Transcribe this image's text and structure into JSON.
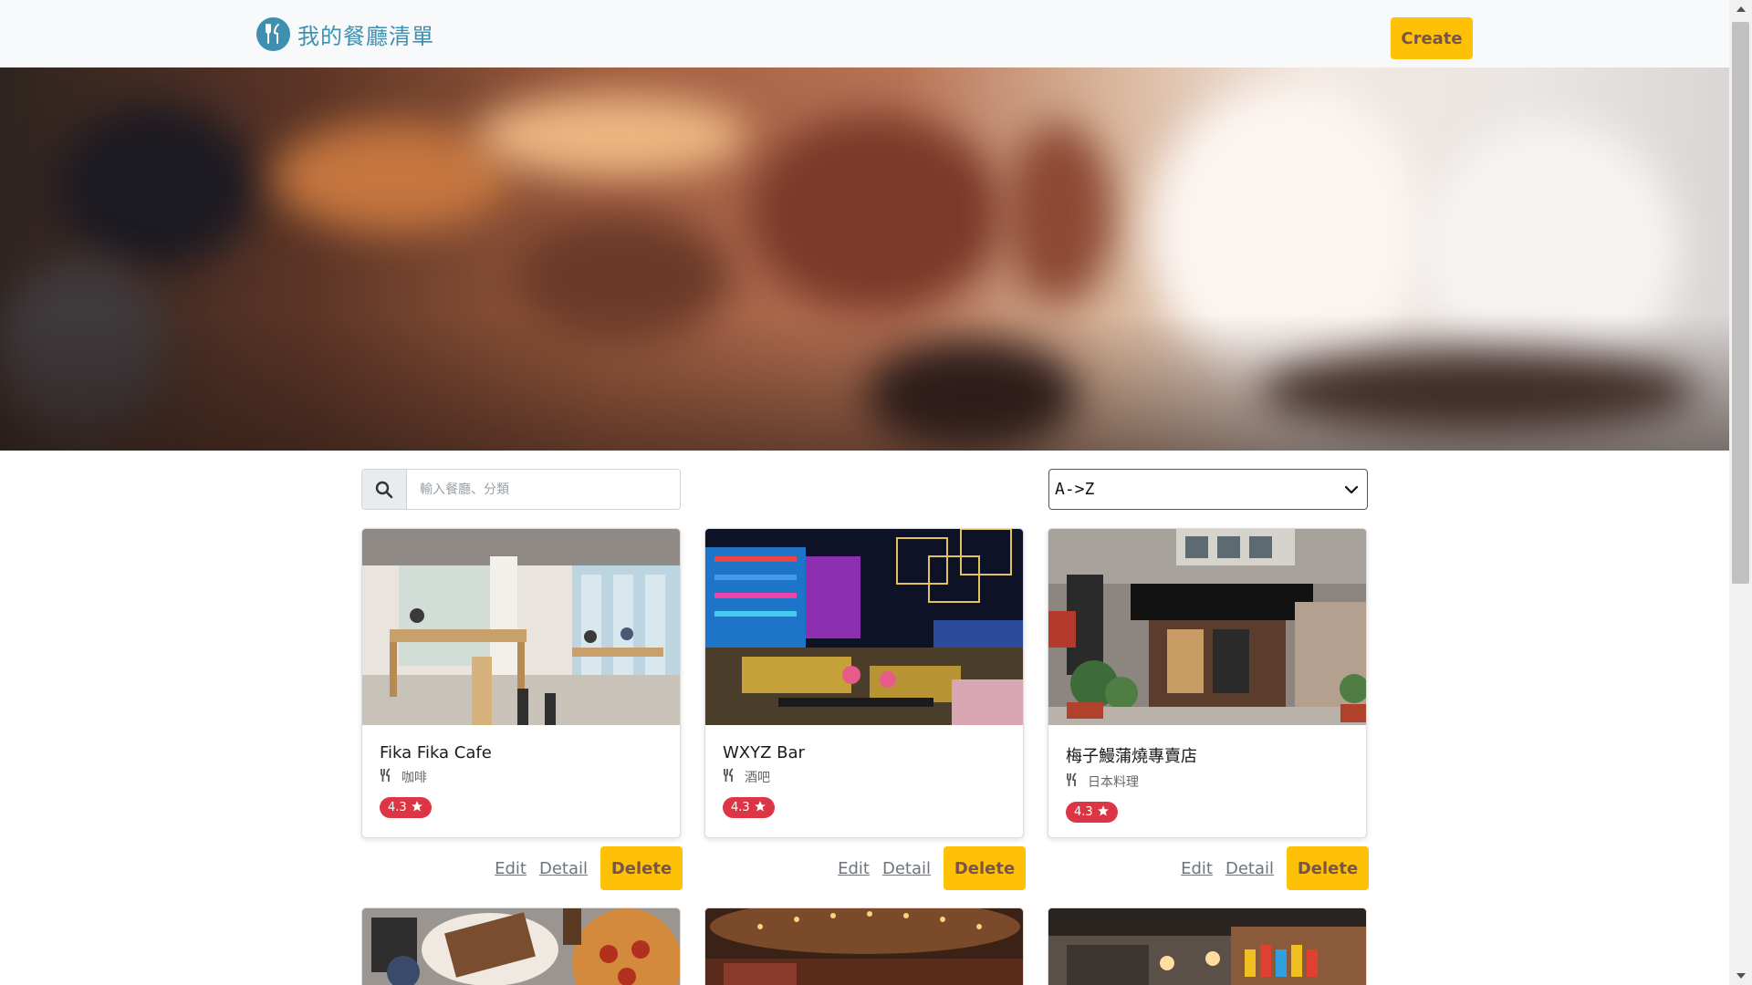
{
  "navbar": {
    "brand": "我的餐廳清單",
    "logo_icon": "utensils-icon",
    "create_label": "Create",
    "accent_color": "#ffc107",
    "brand_color": "#3f8fb0"
  },
  "search": {
    "placeholder": "輸入餐廳、分類",
    "value": "",
    "icon": "search-icon"
  },
  "sort": {
    "selected": "A->Z",
    "icon": "chevron-down-icon"
  },
  "restaurants": [
    {
      "name": "Fika Fika Cafe",
      "category": "咖啡",
      "rating": "4.3"
    },
    {
      "name": "WXYZ Bar",
      "category": "酒吧",
      "rating": "4.3"
    },
    {
      "name": "梅子鰻蒲燒專賣店",
      "category": "日本料理",
      "rating": "4.3"
    }
  ],
  "card_actions": {
    "edit": "Edit",
    "detail": "Detail",
    "delete": "Delete"
  },
  "colors": {
    "rating_badge": "#dc3545",
    "link": "#6c757d"
  }
}
